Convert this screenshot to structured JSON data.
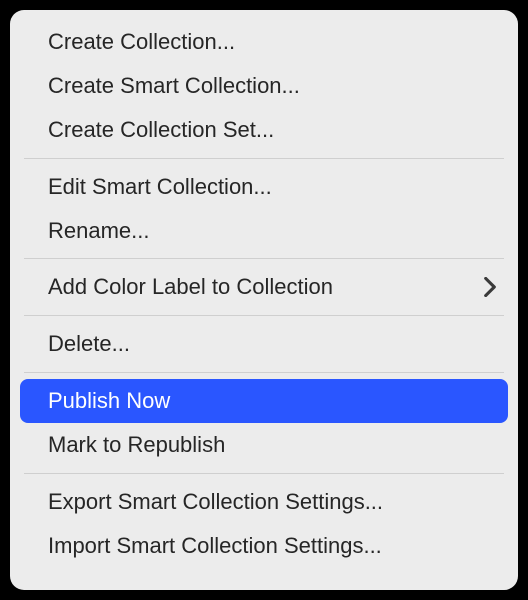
{
  "menu": {
    "createCollection": "Create Collection...",
    "createSmartCollection": "Create Smart Collection...",
    "createCollectionSet": "Create Collection Set...",
    "editSmartCollection": "Edit Smart Collection...",
    "rename": "Rename...",
    "addColorLabel": "Add Color Label to Collection",
    "delete": "Delete...",
    "publishNow": "Publish Now",
    "markToRepublish": "Mark to Republish",
    "exportSmartCollectionSettings": "Export Smart Collection Settings...",
    "importSmartCollectionSettings": "Import Smart Collection Settings..."
  }
}
